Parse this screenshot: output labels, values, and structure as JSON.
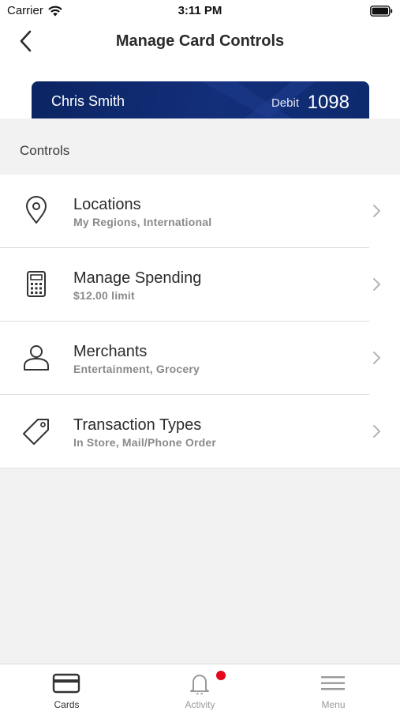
{
  "status_bar": {
    "carrier": "Carrier",
    "time": "3:11 PM"
  },
  "header": {
    "title": "Manage Card Controls",
    "back_icon": "back-chevron-icon"
  },
  "card": {
    "holder": "Chris Smith",
    "type": "Debit",
    "last_digits": "1098",
    "color": "#0b2462"
  },
  "section": {
    "title": "Controls"
  },
  "controls": [
    {
      "title": "Locations",
      "subtitle": "My Regions, International",
      "icon": "location-pin-icon"
    },
    {
      "title": "Manage Spending",
      "subtitle": "$12.00 limit",
      "icon": "calculator-icon"
    },
    {
      "title": "Merchants",
      "subtitle": "Entertainment, Grocery",
      "icon": "person-icon"
    },
    {
      "title": "Transaction Types",
      "subtitle": "In Store, Mail/Phone Order",
      "icon": "tag-icon"
    }
  ],
  "tabs": [
    {
      "label": "Cards",
      "icon": "card-icon",
      "active": true
    },
    {
      "label": "Activity",
      "icon": "bell-icon",
      "badge": true,
      "badge_color": "#e4061b"
    },
    {
      "label": "Menu",
      "icon": "hamburger-icon"
    }
  ]
}
